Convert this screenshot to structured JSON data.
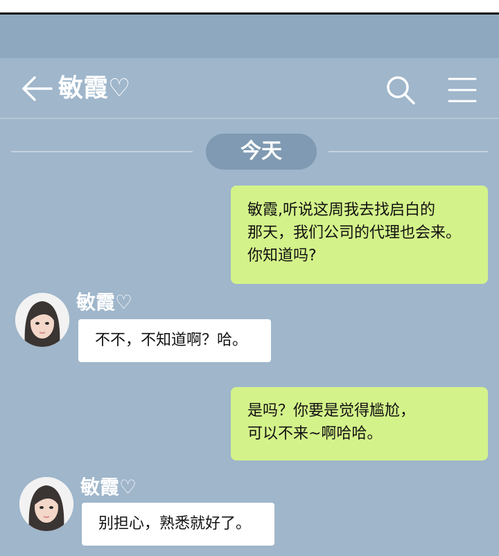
{
  "header": {
    "title": "敏霞♡",
    "back_icon": "back-arrow-icon",
    "search_icon": "search-icon",
    "menu_icon": "menu-icon"
  },
  "date_label": "今天",
  "messages": [
    {
      "direction": "outgoing",
      "lines": [
        "敏霞,听说这周我去找启白的",
        "那天，我们公司的代理也会来。",
        "你知道吗?"
      ]
    },
    {
      "direction": "incoming",
      "sender": "敏霞♡",
      "text": "不不，不知道啊？哈。"
    },
    {
      "direction": "outgoing",
      "lines": [
        "是吗？你要是觉得尴尬，",
        "可以不来~啊哈哈。"
      ]
    },
    {
      "direction": "incoming",
      "sender": "敏霞♡",
      "text": "别担心，熟悉就好了。"
    }
  ],
  "colors": {
    "background": "#9fb6cb",
    "outgoing_bubble": "#d4f28a",
    "incoming_bubble": "#ffffff",
    "date_pill": "#7f9ab2"
  }
}
